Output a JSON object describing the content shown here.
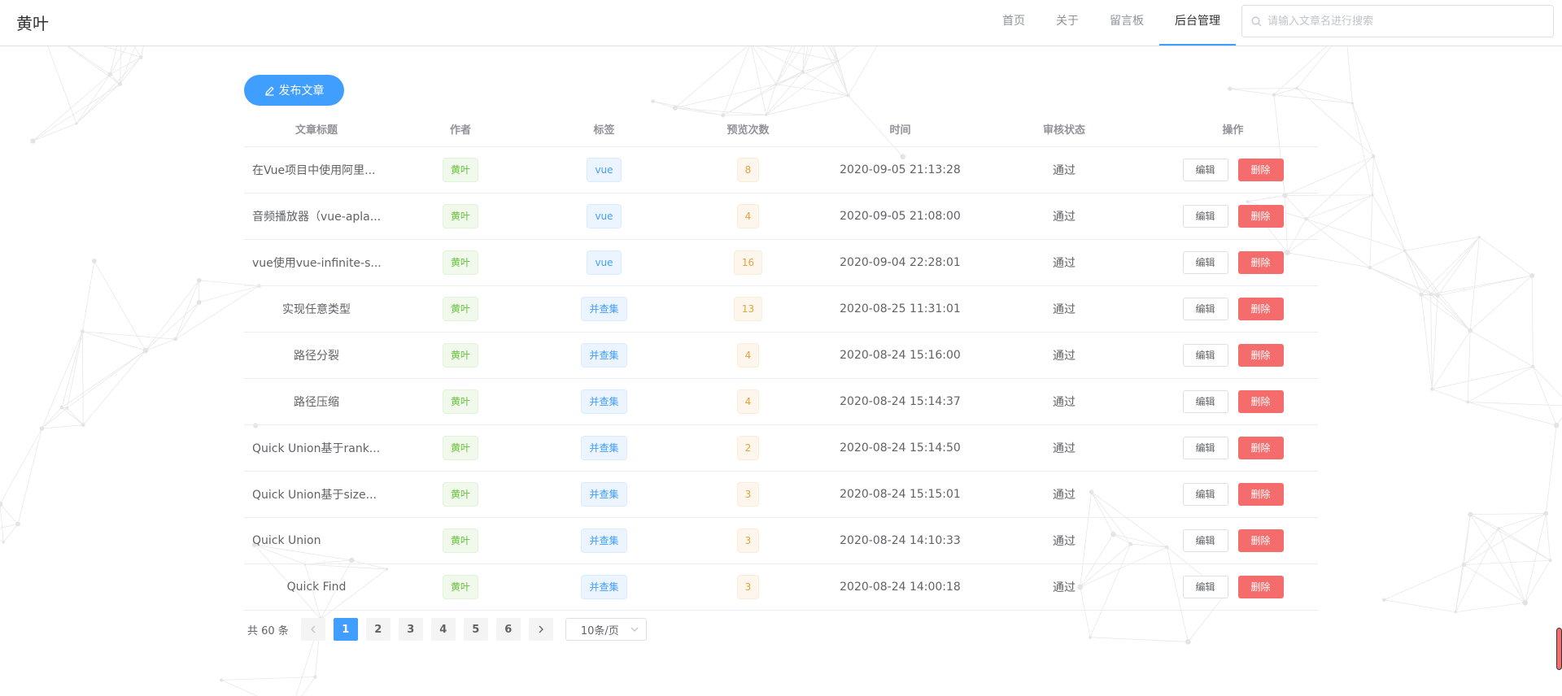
{
  "app": {
    "logo": "黄叶"
  },
  "nav": {
    "items": [
      {
        "label": "首页"
      },
      {
        "label": "关于"
      },
      {
        "label": "留言板"
      },
      {
        "label": "后台管理"
      }
    ],
    "active_index": 3
  },
  "search": {
    "placeholder": "请输入文章名进行搜索",
    "value": ""
  },
  "toolbar": {
    "publish_label": "发布文章"
  },
  "table": {
    "headers": [
      "文章标题",
      "作者",
      "标签",
      "预览次数",
      "时间",
      "审核状态",
      "操作"
    ],
    "rows": [
      {
        "title": "在Vue项目中使用阿里...",
        "author": "黄叶",
        "tag": "vue",
        "views": "8",
        "time": "2020-09-05 21:13:28",
        "status": "通过"
      },
      {
        "title": "音频播放器（vue-apla...",
        "author": "黄叶",
        "tag": "vue",
        "views": "4",
        "time": "2020-09-05 21:08:00",
        "status": "通过"
      },
      {
        "title": "vue使用vue-infinite-s...",
        "author": "黄叶",
        "tag": "vue",
        "views": "16",
        "time": "2020-09-04 22:28:01",
        "status": "通过"
      },
      {
        "title": "实现任意类型",
        "author": "黄叶",
        "tag": "并查集",
        "views": "13",
        "time": "2020-08-25 11:31:01",
        "status": "通过"
      },
      {
        "title": "路径分裂",
        "author": "黄叶",
        "tag": "并查集",
        "views": "4",
        "time": "2020-08-24 15:16:00",
        "status": "通过"
      },
      {
        "title": "路径压缩",
        "author": "黄叶",
        "tag": "并查集",
        "views": "4",
        "time": "2020-08-24 15:14:37",
        "status": "通过"
      },
      {
        "title": "Quick Union基于rank...",
        "author": "黄叶",
        "tag": "并查集",
        "views": "2",
        "time": "2020-08-24 15:14:50",
        "status": "通过"
      },
      {
        "title": "Quick Union基于size...",
        "author": "黄叶",
        "tag": "并查集",
        "views": "3",
        "time": "2020-08-24 15:15:01",
        "status": "通过"
      },
      {
        "title": "Quick Union",
        "author": "黄叶",
        "tag": "并查集",
        "views": "3",
        "time": "2020-08-24 14:10:33",
        "status": "通过"
      },
      {
        "title": "Quick Find",
        "author": "黄叶",
        "tag": "并查集",
        "views": "3",
        "time": "2020-08-24 14:00:18",
        "status": "通过"
      }
    ],
    "actions": {
      "edit_label": "编辑",
      "delete_label": "删除"
    }
  },
  "pagination": {
    "total_label": "共 60 条",
    "pages": [
      "1",
      "2",
      "3",
      "4",
      "5",
      "6"
    ],
    "current": "1",
    "page_size_label": "10条/页"
  },
  "colors": {
    "primary": "#409eff",
    "danger": "#f56c6c",
    "success_tag": "#67c23a",
    "warning_tag": "#e6a23c"
  },
  "icons": {
    "search": "search-icon",
    "publish": "edit-icon",
    "prev": "chevron-left-icon",
    "next": "chevron-right-icon",
    "select": "chevron-down-icon"
  }
}
